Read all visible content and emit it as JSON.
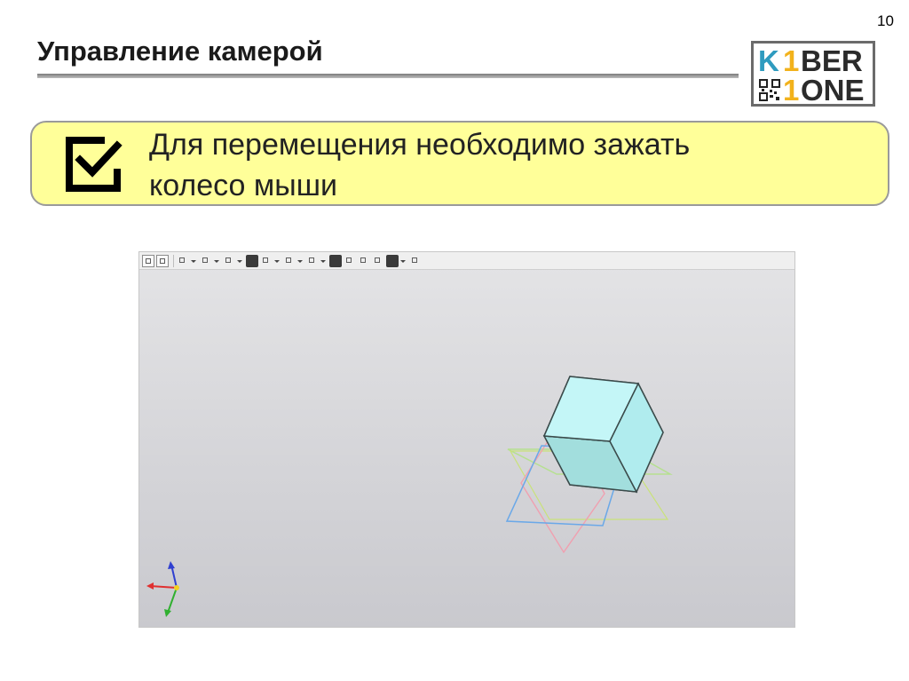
{
  "slide": {
    "page_number": "10",
    "title": "Управление камерой"
  },
  "logo": {
    "line1_letter": "K",
    "line1_digit": "1",
    "line1_rest": "BER",
    "line2_digit": "1",
    "line2_rest": "ONE",
    "colors": {
      "k": "#2f9bbf",
      "digit": "#f2b21c",
      "text": "#2b2b2b"
    }
  },
  "callout": {
    "icon": "checkbox-checked-icon",
    "lines": [
      "Для перемещения необходимо зажать",
      "колесо мыши"
    ],
    "background": "#ffff99"
  },
  "viewport": {
    "toolbar_icons": [
      "grid-icon",
      "orient-icon",
      "zoom-icon",
      "pan-icon",
      "rotate-icon",
      "view-cube-icon",
      "display-mode-icon",
      "section-icon",
      "render-icon",
      "hide-icon",
      "show-icon",
      "filter-icon",
      "select-icon",
      "pencil-icon"
    ],
    "cube_color": "#b8f2f4",
    "axis_colors": {
      "x": "#e03030",
      "y": "#30b030",
      "z": "#3040d0"
    }
  }
}
